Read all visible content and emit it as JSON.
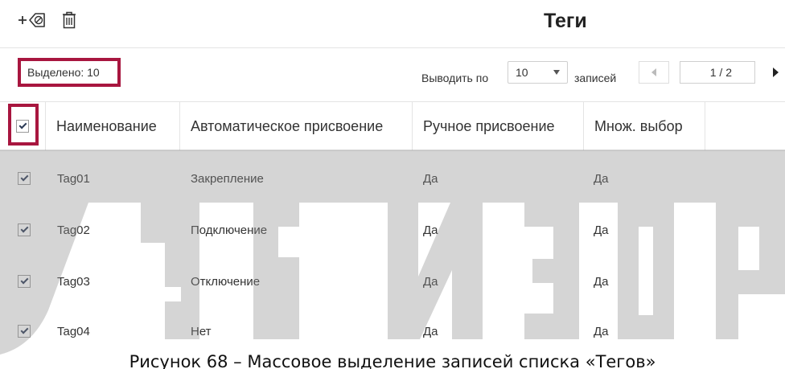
{
  "toolbar": {
    "add_tag_icon": "add-tag-icon",
    "delete_icon": "trash-icon"
  },
  "page_title": "Теги",
  "selection": {
    "label": "Выделено: 10"
  },
  "pager": {
    "show_label": "Выводить по",
    "per_page": "10",
    "records_label": "записей",
    "page": "1 / 2"
  },
  "table": {
    "columns": [
      "Наименование",
      "Автоматическое присвоение",
      "Ручное присвоение",
      "Множ. выбор"
    ],
    "header_checked": true,
    "rows": [
      {
        "checked": true,
        "name": "Tag01",
        "auto": "Закрепление",
        "manual": "Да",
        "multi": "Да"
      },
      {
        "checked": true,
        "name": "Tag02",
        "auto": "Подключение",
        "manual": "Да",
        "multi": "Да"
      },
      {
        "checked": true,
        "name": "Tag03",
        "auto": "Отключение",
        "manual": "Да",
        "multi": "Да"
      },
      {
        "checked": true,
        "name": "Tag04",
        "auto": "Нет",
        "manual": "Да",
        "multi": "Да"
      }
    ]
  },
  "colors": {
    "highlight": "#a8163f",
    "watermark": "#cfcfcf"
  },
  "caption": "Рисунок 68 – Массовое выделение записей списка «Тегов»"
}
